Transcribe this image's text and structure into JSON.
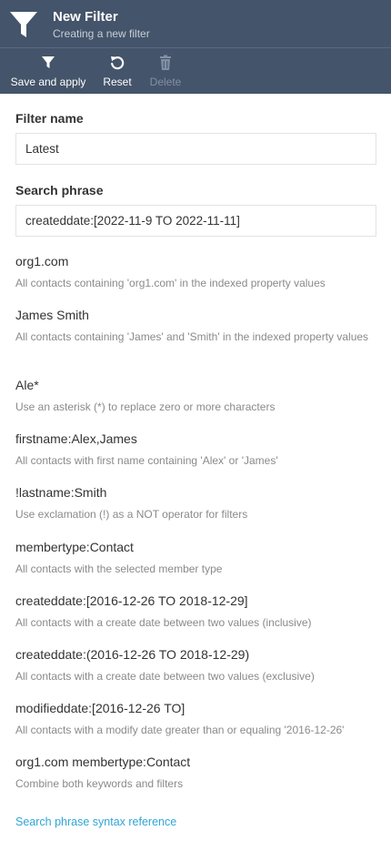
{
  "header": {
    "title": "New Filter",
    "subtitle": "Creating a new filter",
    "icon": "filter-icon"
  },
  "toolbar": {
    "save_label": "Save and apply",
    "reset_label": "Reset",
    "delete_label": "Delete"
  },
  "form": {
    "filter_name_label": "Filter name",
    "filter_name_value": "Latest",
    "search_phrase_label": "Search phrase",
    "search_phrase_value": "createddate:[2022-11-9 TO 2022-11-11]"
  },
  "examples": [
    {
      "phrase": "org1.com",
      "desc": "All contacts containing 'org1.com' in the indexed property values"
    },
    {
      "phrase": "James Smith",
      "desc": "All contacts containing 'James' and 'Smith' in the indexed property values"
    },
    {
      "phrase": "Ale*",
      "desc": "Use an asterisk (*) to replace zero or more characters"
    },
    {
      "phrase": "firstname:Alex,James",
      "desc": "All contacts with first name containing 'Alex' or 'James'"
    },
    {
      "phrase": "!lastname:Smith",
      "desc": "Use exclamation (!) as a NOT operator for filters"
    },
    {
      "phrase": "membertype:Contact",
      "desc": "All contacts with the selected member type"
    },
    {
      "phrase": "createddate:[2016-12-26 TO 2018-12-29]",
      "desc": "All contacts with a create date between two values (inclusive)"
    },
    {
      "phrase": "createddate:(2016-12-26 TO 2018-12-29)",
      "desc": "All contacts with a create date between two values (exclusive)"
    },
    {
      "phrase": "modifieddate:[2016-12-26 TO]",
      "desc": "All contacts with a modify date greater than or equaling '2016-12-26'"
    },
    {
      "phrase": "org1.com membertype:Contact",
      "desc": "Combine both keywords and filters"
    }
  ],
  "reference_link": "Search phrase syntax reference",
  "colors": {
    "header_bg": "#44546a",
    "link": "#2fa6d6",
    "description": "#8a8a8a"
  }
}
